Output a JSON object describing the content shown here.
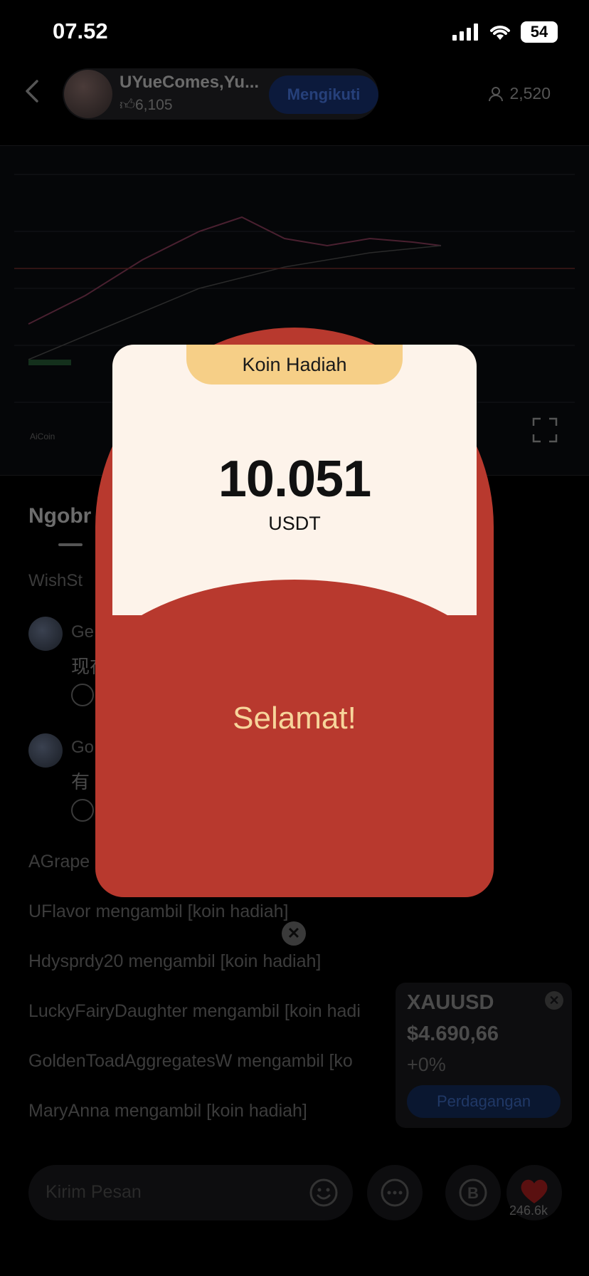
{
  "status_bar": {
    "time": "07.52",
    "battery": "54"
  },
  "header": {
    "host_name": "UYueComes,Yu...",
    "likes": "6,105",
    "follow_label": "Mengikuti",
    "viewers": "2,520"
  },
  "chart": {
    "watermark": "AiCoin"
  },
  "chat": {
    "section_title": "Ngobr",
    "notice": "WishSt",
    "messages": [
      {
        "name": "Ge",
        "text": "现在"
      },
      {
        "name": "Go",
        "text": "有"
      }
    ],
    "system_messages": [
      "AGrape",
      "UFlavor mengambil [koin hadiah]",
      "Hdysprdy20 mengambil [koin hadiah]",
      "LuckyFairyDaughter mengambil [koin hadi",
      "GoldenToadAggregatesW mengambil [ko",
      "MaryAnna mengambil [koin hadiah]"
    ]
  },
  "ticker": {
    "symbol": "XAUUSD",
    "price": "$4.690,66",
    "change": "+0%",
    "trade_label": "Perdagangan"
  },
  "bottom_bar": {
    "input_placeholder": "Kirim Pesan",
    "like_count": "246.6k"
  },
  "modal": {
    "tab_label": "Koin Hadiah",
    "amount": "10.051",
    "unit": "USDT",
    "congrats": "Selamat!",
    "colors": {
      "red": "#b8392e",
      "card": "#fdf3ea",
      "tab": "#f6cf87",
      "congrats_text": "#f7d59b"
    }
  }
}
